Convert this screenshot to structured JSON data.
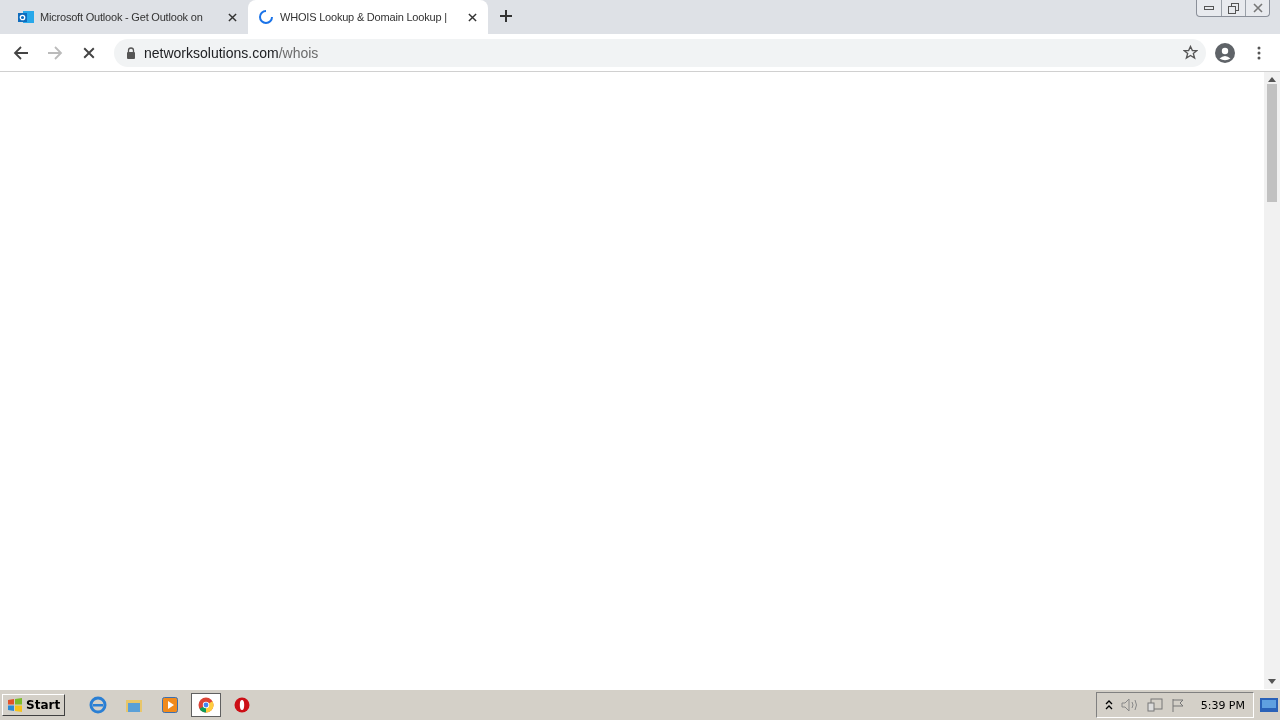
{
  "tabs": [
    {
      "title": "Microsoft Outlook - Get Outlook on",
      "selected": false,
      "loading": false
    },
    {
      "title": "WHOIS Lookup & Domain Lookup |",
      "selected": true,
      "loading": true
    }
  ],
  "toolbar": {
    "forward_disabled": true,
    "loading": true
  },
  "address_bar": {
    "host": "networksolutions.com",
    "path": "/whois"
  },
  "taskbar": {
    "start_label": "Start",
    "apps": [
      {
        "kind": "ie",
        "selected": false
      },
      {
        "kind": "folder",
        "selected": false
      },
      {
        "kind": "media",
        "selected": false
      },
      {
        "kind": "chrome",
        "selected": true
      },
      {
        "kind": "opera",
        "selected": false
      }
    ],
    "clock": "5:39 PM"
  }
}
